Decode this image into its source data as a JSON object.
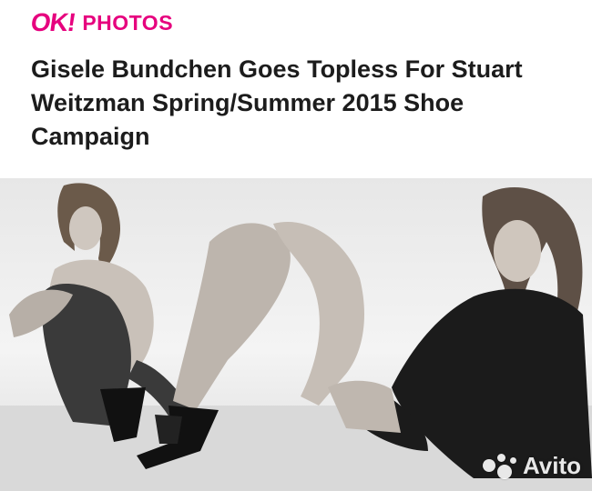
{
  "header": {
    "logo_text": "OK!",
    "section_label": "PHOTOS",
    "headline": "Gisele Bundchen Goes Topless For Stuart Weitzman Spring/Summer 2015 Shoe Campaign"
  },
  "photo": {
    "description": "campaign-photo",
    "watermark_text": "Avito"
  },
  "colors": {
    "accent": "#e6007e",
    "headline": "#1c1c1c",
    "background": "#ffffff"
  }
}
